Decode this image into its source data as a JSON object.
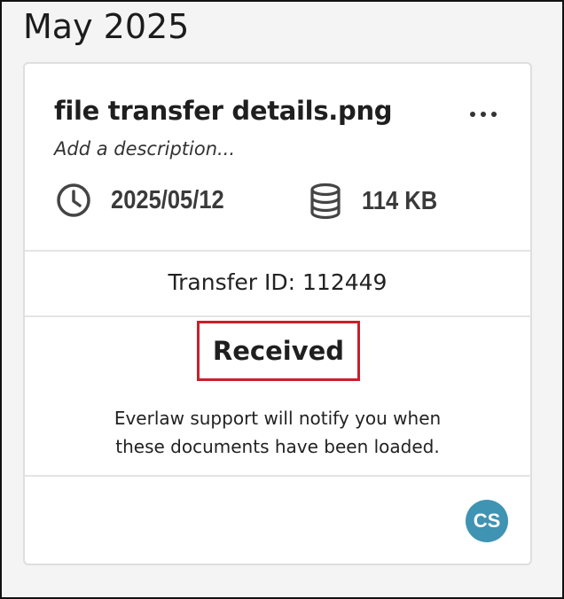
{
  "month_header": "May 2025",
  "card": {
    "file_name": "file transfer details.png",
    "description_placeholder": "Add a description...",
    "date": "2025/05/12",
    "size": "114 KB",
    "transfer_id": "Transfer ID: 112449",
    "status": "Received",
    "notice_line1": "Everlaw support will notify you when",
    "notice_line2": "these documents have been loaded.",
    "avatar_initials": "CS"
  },
  "icons": {
    "more": "more-options-icon",
    "date": "clock-icon",
    "size": "database-icon"
  },
  "colors": {
    "status_highlight": "#c8202b",
    "avatar": "#3f93b3"
  }
}
